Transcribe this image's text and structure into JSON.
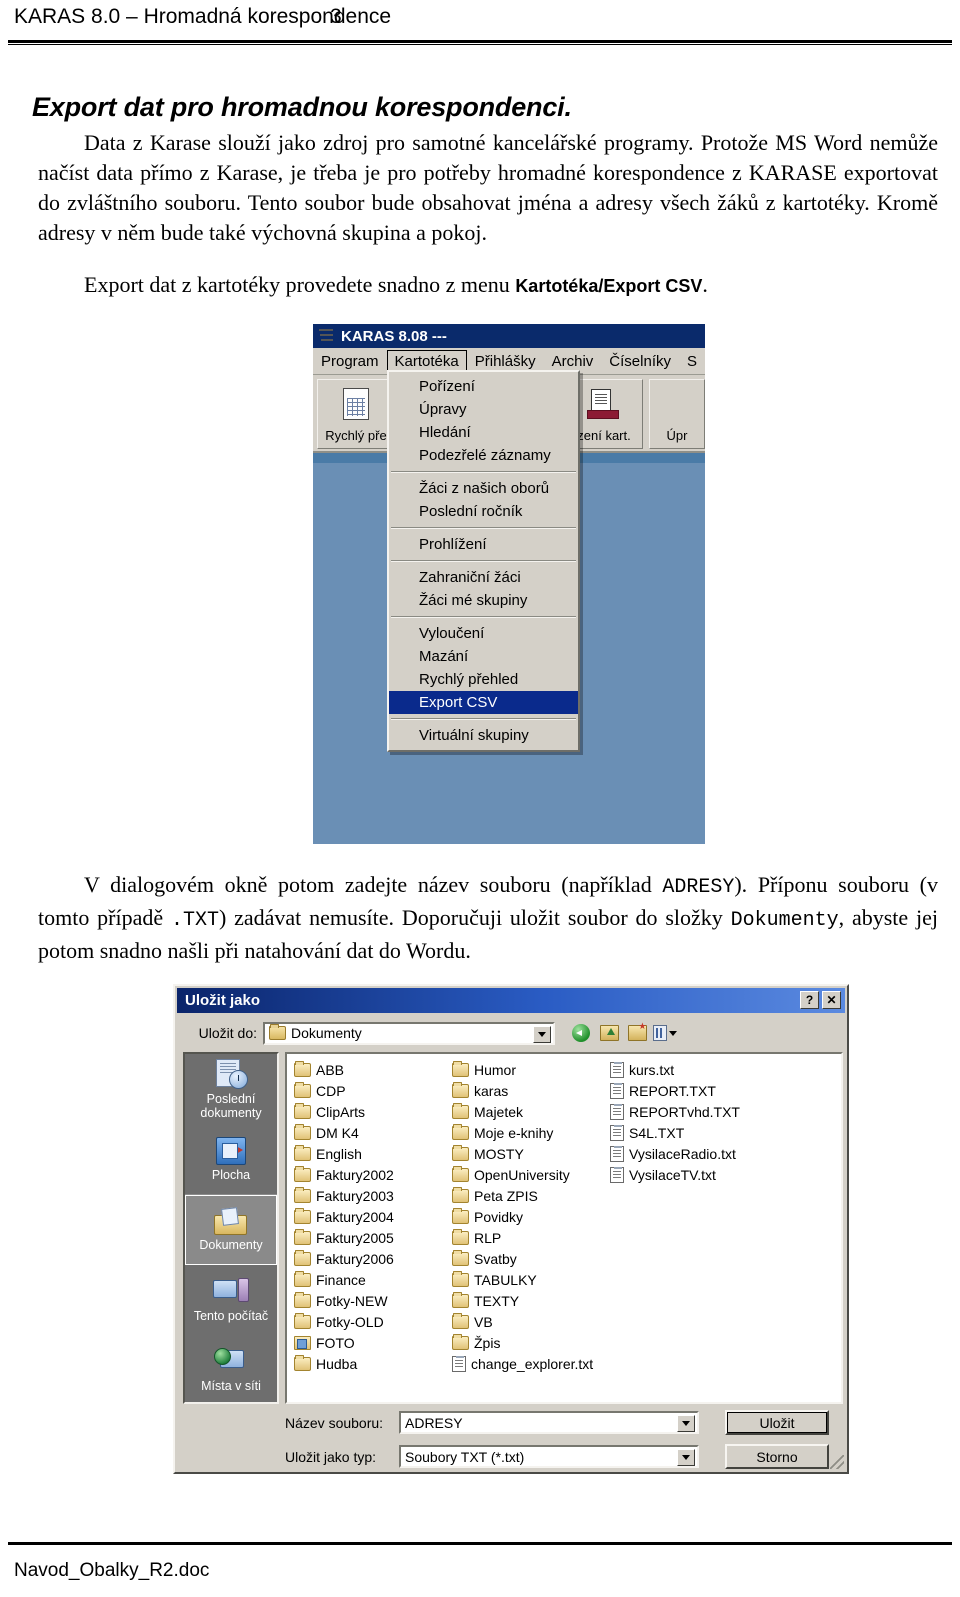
{
  "header": {
    "title": "KARAS 8.0 – Hromadná korespondence",
    "page_number": "3"
  },
  "section": {
    "title": "Export dat pro hromadnou korespondenci.",
    "paragraph_1_a": "Data z Karase slouží jako zdroj pro samotné kancelářské programy. Protože MS Word nemůže načíst data přímo z Karase, je třeba je pro potřeby hromadné korespondence z KARASE exportovat do zvláštního souboru. Tento soubor bude obsahovat jména a adresy všech žáků z kartotéky. Kromě adresy v něm bude také výchovná skupina a pokoj.",
    "paragraph_2_a": "Export dat z kartotéky provedete snadno z menu ",
    "paragraph_2_menu": "Kartotéka/Export CSV",
    "paragraph_2_b": ".",
    "paragraph_3_a": "V dialogovém okně potom zadejte název souboru (například ",
    "paragraph_3_code1": "ADRESY",
    "paragraph_3_b": "). Příponu souboru (v tomto případě ",
    "paragraph_3_code2": ".TXT",
    "paragraph_3_c": ") zadávat nemusíte. Doporučuji uložit soubor do složky ",
    "paragraph_3_code3": "Dokumenty",
    "paragraph_3_d": ", abyste jej potom snadno našli při natahování dat do Wordu."
  },
  "karas_window": {
    "title": "KARAS 8.08   ---",
    "icon": "app-stack-icon",
    "menubar": [
      {
        "label": "Program",
        "active": false
      },
      {
        "label": "Kartotéka",
        "active": true
      },
      {
        "label": "Přihlášky",
        "active": false
      },
      {
        "label": "Archiv",
        "active": false
      },
      {
        "label": "Číselníky",
        "active": false
      },
      {
        "label": "S",
        "active": false
      }
    ],
    "toolbar": [
      {
        "label": "Rychlý pře",
        "icon": "document-table-icon"
      },
      {
        "label": "zení kart.",
        "icon": "printer-icon"
      },
      {
        "label": "Úpr",
        "icon": "edit-icon"
      }
    ],
    "dropdown": [
      {
        "label": "Pořízení",
        "type": "item",
        "selected": false
      },
      {
        "label": "Úpravy",
        "type": "item",
        "selected": false
      },
      {
        "label": "Hledání",
        "type": "item",
        "selected": false
      },
      {
        "label": "Podezřelé záznamy",
        "type": "item",
        "selected": false
      },
      {
        "label": "",
        "type": "separator",
        "selected": false
      },
      {
        "label": "Žáci z našich oborů",
        "type": "item",
        "selected": false
      },
      {
        "label": "Poslední ročník",
        "type": "item",
        "selected": false
      },
      {
        "label": "",
        "type": "separator",
        "selected": false
      },
      {
        "label": "Prohlížení",
        "type": "item",
        "selected": false
      },
      {
        "label": "",
        "type": "separator",
        "selected": false
      },
      {
        "label": "Zahraniční žáci",
        "type": "item",
        "selected": false
      },
      {
        "label": "Žáci mé skupiny",
        "type": "item",
        "selected": false
      },
      {
        "label": "",
        "type": "separator",
        "selected": false
      },
      {
        "label": "Vyloučení",
        "type": "item",
        "selected": false
      },
      {
        "label": "Mazání",
        "type": "item",
        "selected": false
      },
      {
        "label": "Rychlý přehled",
        "type": "item",
        "selected": false
      },
      {
        "label": "Export CSV",
        "type": "item",
        "selected": true
      },
      {
        "label": "",
        "type": "separator",
        "selected": false
      },
      {
        "label": "Virtuální skupiny",
        "type": "item",
        "selected": false
      }
    ]
  },
  "save_dialog": {
    "title": "Uložit jako",
    "help_button": "?",
    "close_button": "✕",
    "save_in_label": "Uložit do:",
    "save_in_value": "Dokumenty",
    "nav_buttons": [
      "back-icon",
      "up-one-level-icon",
      "new-folder-icon",
      "views-icon"
    ],
    "places": [
      {
        "label": "Poslední dokumenty",
        "icon": "recent-documents-icon",
        "selected": false
      },
      {
        "label": "Plocha",
        "icon": "desktop-icon",
        "selected": false
      },
      {
        "label": "Dokumenty",
        "icon": "my-documents-icon",
        "selected": true
      },
      {
        "label": "Tento počítač",
        "icon": "my-computer-icon",
        "selected": false
      },
      {
        "label": "Místa v síti",
        "icon": "network-places-icon",
        "selected": false
      }
    ],
    "file_columns": [
      [
        {
          "name": "ABB",
          "type": "folder"
        },
        {
          "name": "CDP",
          "type": "folder"
        },
        {
          "name": "ClipArts",
          "type": "folder"
        },
        {
          "name": "DM K4",
          "type": "folder"
        },
        {
          "name": "English",
          "type": "folder"
        },
        {
          "name": "Faktury2002",
          "type": "folder"
        },
        {
          "name": "Faktury2003",
          "type": "folder"
        },
        {
          "name": "Faktury2004",
          "type": "folder"
        },
        {
          "name": "Faktury2005",
          "type": "folder"
        },
        {
          "name": "Faktury2006",
          "type": "folder"
        },
        {
          "name": "Finance",
          "type": "folder"
        },
        {
          "name": "Fotky-NEW",
          "type": "folder"
        },
        {
          "name": "Fotky-OLD",
          "type": "folder"
        },
        {
          "name": "FOTO",
          "type": "folder-image"
        },
        {
          "name": "Hudba",
          "type": "folder"
        }
      ],
      [
        {
          "name": "Humor",
          "type": "folder"
        },
        {
          "name": "karas",
          "type": "folder"
        },
        {
          "name": "Majetek",
          "type": "folder"
        },
        {
          "name": "Moje e-knihy",
          "type": "folder"
        },
        {
          "name": "MOSTY",
          "type": "folder"
        },
        {
          "name": "OpenUniversity",
          "type": "folder"
        },
        {
          "name": "Peta ZPIS",
          "type": "folder"
        },
        {
          "name": "Povidky",
          "type": "folder"
        },
        {
          "name": "RLP",
          "type": "folder"
        },
        {
          "name": "Svatby",
          "type": "folder"
        },
        {
          "name": "TABULKY",
          "type": "folder"
        },
        {
          "name": "TEXTY",
          "type": "folder"
        },
        {
          "name": "VB",
          "type": "folder"
        },
        {
          "name": "Žpis",
          "type": "folder"
        },
        {
          "name": "change_explorer.txt",
          "type": "text-file"
        }
      ],
      [
        {
          "name": "kurs.txt",
          "type": "text-file"
        },
        {
          "name": "REPORT.TXT",
          "type": "text-file"
        },
        {
          "name": "REPORTvhd.TXT",
          "type": "text-file"
        },
        {
          "name": "S4L.TXT",
          "type": "text-file"
        },
        {
          "name": "VysilaceRadio.txt",
          "type": "text-file"
        },
        {
          "name": "VysilaceTV.txt",
          "type": "text-file"
        }
      ]
    ],
    "filename_label": "Název souboru:",
    "filename_value": "ADRESY",
    "filetype_label": "Uložit jako typ:",
    "filetype_value": "Soubory TXT (*.txt)",
    "save_button": "Uložit",
    "cancel_button": "Storno"
  },
  "footer": {
    "filename": "Navod_Obalky_R2.doc"
  }
}
